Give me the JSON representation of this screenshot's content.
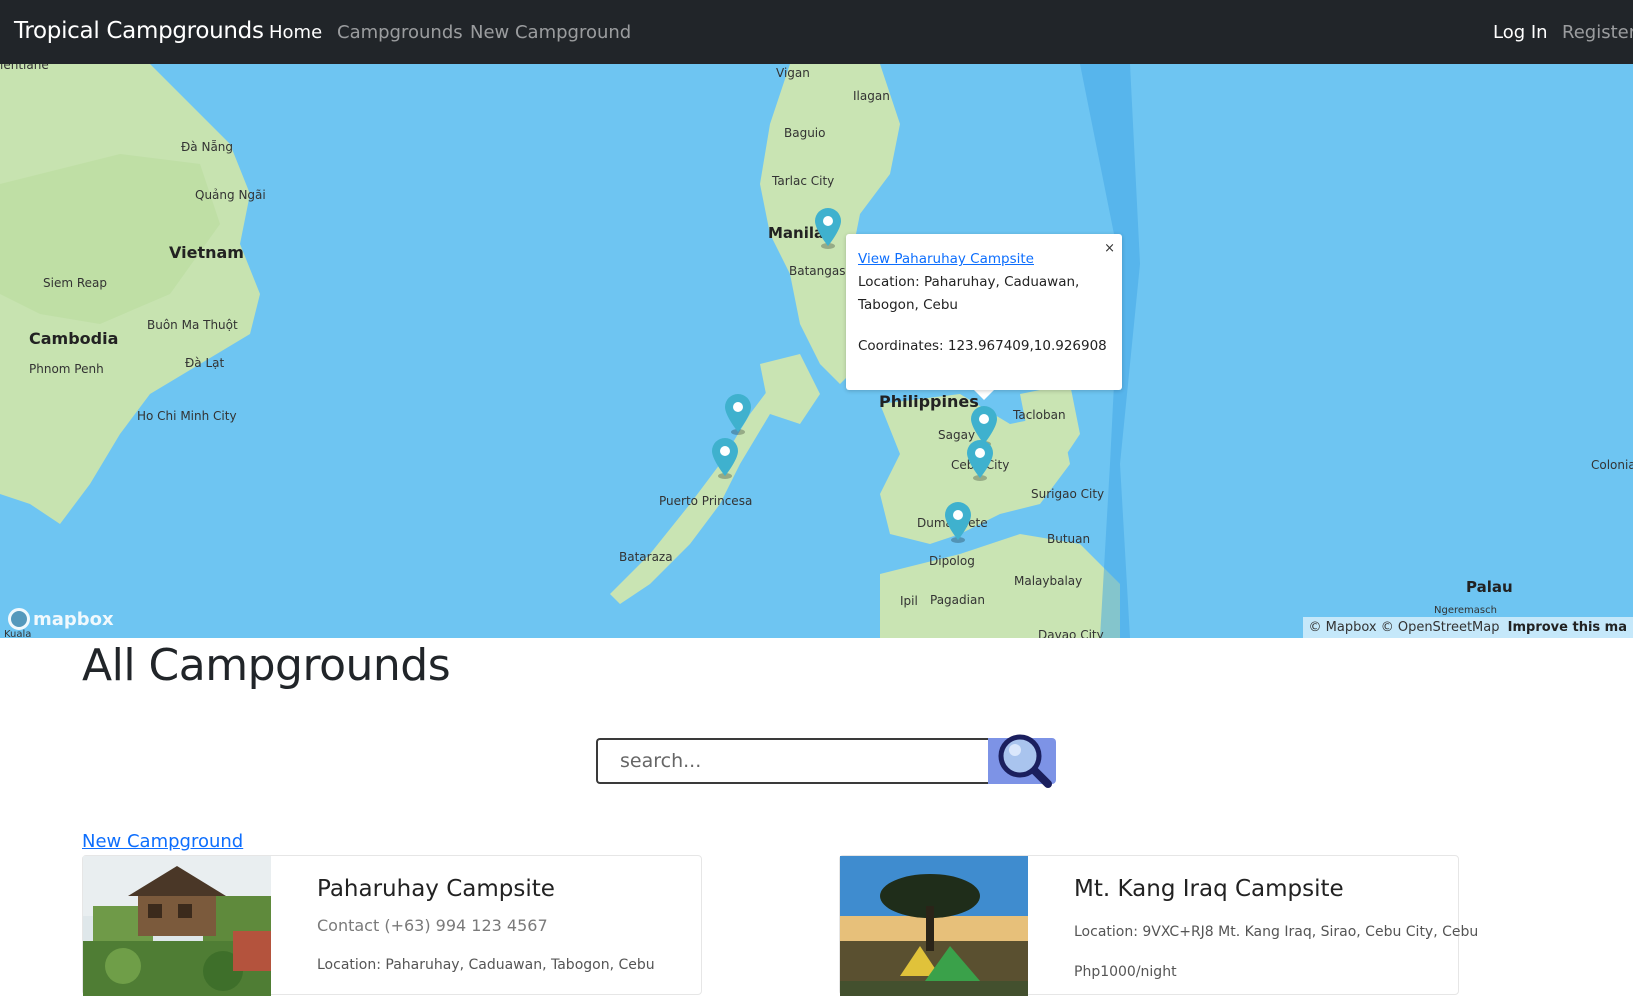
{
  "navbar": {
    "brand": "Tropical Campgrounds",
    "links": [
      "Home",
      "Campgrounds",
      "New Campground"
    ],
    "login": "Log In",
    "register": "Register"
  },
  "map": {
    "labels": {
      "vientiane": "ientiane",
      "vigan": "Vigan",
      "ilagan": "Ilagan",
      "danang": "Đà Nẵng",
      "baguio": "Baguio",
      "quangngai": "Quảng Ngãi",
      "tarlac": "Tarlac City",
      "vietnam": "Vietnam",
      "manila": "Manila",
      "siemreap": "Siem Reap",
      "batangas": "Batangas",
      "buonmathuot": "Buôn Ma Thuột",
      "cambodia": "Cambodia",
      "dalat": "Đà Lạt",
      "phnompenh": "Phnom Penh",
      "philippines": "Philippines",
      "hochiminh": "Ho Chi Minh City",
      "tacloban": "Tacloban",
      "sagay": "Sagay",
      "cebucity": "Cebu City",
      "colonia": "Colonia",
      "puertoprincesa": "Puerto Princesa",
      "surigao": "Surigao City",
      "dumaguete": "Dumaguete",
      "butuan": "Butuan",
      "bataraza": "Bataraza",
      "dipolog": "Dipolog",
      "malaybalay": "Malaybalay",
      "palau": "Palau",
      "ngeremasch": "Ngeremasch",
      "ipil": "Ipil",
      "pagadian": "Pagadian",
      "davao": "Davao City",
      "kuala": "Kuala"
    },
    "logo": "mapbox",
    "attribution": "© Mapbox © OpenStreetMap",
    "improve": "Improve this ma",
    "popup": {
      "link": "View Paharuhay Campsite",
      "location": "Location: Paharuhay, Caduawan, Tabogon, Cebu",
      "coordinates": "Coordinates: 123.967409,10.926908",
      "close": "×"
    },
    "marker_color": "#3fb1ce"
  },
  "main": {
    "title": "All Campgrounds",
    "search_placeholder": "search...",
    "new_link": "New Campground"
  },
  "campgrounds": [
    {
      "title": "Paharuhay Campsite",
      "contact": "Contact (+63) 994 123 4567",
      "location": "Location: Paharuhay, Caduawan, Tabogon, Cebu"
    },
    {
      "title": "Mt. Kang Iraq Campsite",
      "location": "Location: 9VXC+RJ8 Mt. Kang Iraq, Sirao, Cebu City, Cebu",
      "price": "Php1000/night"
    }
  ]
}
